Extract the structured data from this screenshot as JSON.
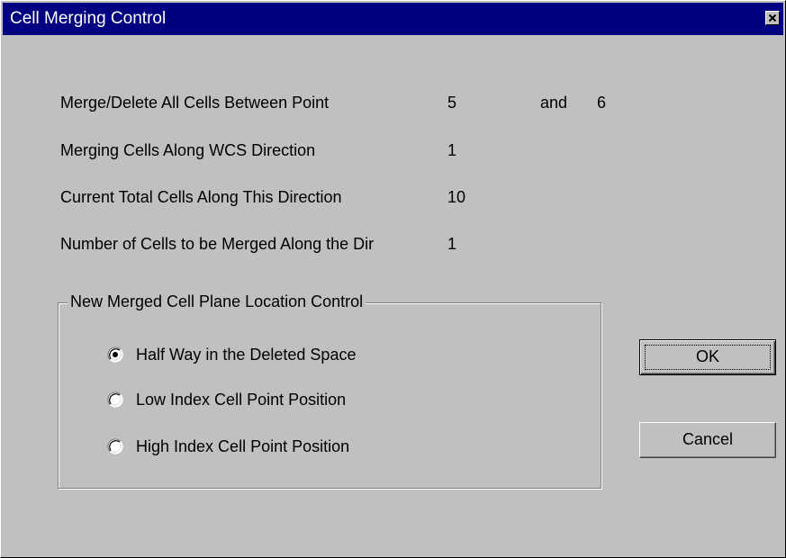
{
  "window": {
    "title": "Cell Merging Control"
  },
  "rows": {
    "merge_delete": {
      "label": "Merge/Delete All Cells Between Point",
      "from": "5",
      "and_label": "and",
      "to": "6"
    },
    "wcs_direction": {
      "label": "Merging Cells Along WCS Direction",
      "value": "1"
    },
    "total_cells": {
      "label": "Current Total Cells Along This Direction",
      "value": "10"
    },
    "cells_merged": {
      "label": "Number of Cells to be Merged Along the Dir",
      "value": "1"
    }
  },
  "group": {
    "title": "New Merged Cell Plane Location Control",
    "options": [
      {
        "label": "Half Way in the Deleted Space",
        "selected": true
      },
      {
        "label": "Low Index Cell Point Position",
        "selected": false
      },
      {
        "label": "High Index Cell Point Position",
        "selected": false
      }
    ]
  },
  "buttons": {
    "ok": "OK",
    "cancel": "Cancel"
  },
  "icons": {
    "close": "close-icon",
    "radio": "radio-button-icon"
  },
  "colors": {
    "titlebar": "#000080",
    "face": "#c0c0c0"
  }
}
